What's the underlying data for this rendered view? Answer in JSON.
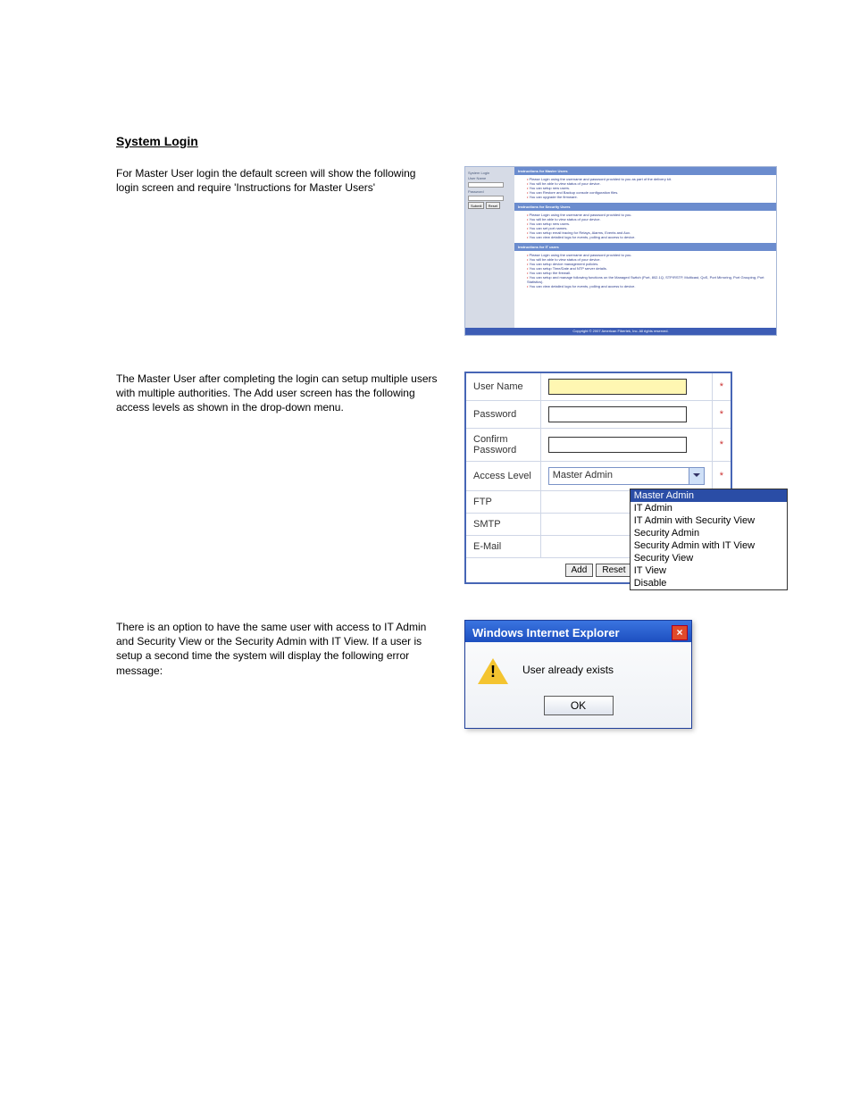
{
  "section_title": "System Login",
  "intro_text": "For Master User login the default screen will show the following login screen and require 'Instructions for Master Users'",
  "login_panel": {
    "title": "System Login",
    "user_label": "User Name",
    "pass_label": "Password",
    "submit": "Submit",
    "reset": "Reset",
    "group1_head": "Instructions for Master Users",
    "group1_items": [
      "Please Login using the username and password provided to you as part of the delivery kit.",
      "You will be able to view status of your device.",
      "You can setup new users.",
      "You can Restore and Backup console configuration files.",
      "You can upgrade the firmware."
    ],
    "group2_head": "Instructions for Security Users",
    "group2_items": [
      "Please Login using the username and password provided to you.",
      "You will be able to view status of your device.",
      "You can setup new users.",
      "You can set port names.",
      "You can setup email tracing for Relays, Alarms, Events and Aux.",
      "You can view detailed logs for events, polling and access to device."
    ],
    "group3_head": "Instructions for IT users",
    "group3_items": [
      "Please Login using the username and password provided to you.",
      "You will be able to view status of your device.",
      "You can setup device management policies.",
      "You can setup Time/Date and NTP server details.",
      "You can setup the firewall.",
      "You can setup and manage following functions on the Managed Switch (Port, 802.1Q, STP/RSTP, Multicast, QoS, Port Mirroring, Port Grouping, Port Statistics).",
      "You can view detailed logs for events, polling and access to device."
    ],
    "footer": "Copyright © 2007 American Fibertek, Inc. All rights reserved."
  },
  "adduser_text": "The Master User after completing the login can setup multiple users with multiple authorities. The Add user screen has the following access levels as shown in the drop-down menu.",
  "form": {
    "username_label": "User Name",
    "password_label": "Password",
    "confirm_label": "Confirm Password",
    "access_label": "Access Level",
    "ftp_label": "FTP",
    "smtp_label": "SMTP",
    "email_label": "E-Mail",
    "selected_level": "Master Admin",
    "options": [
      "Master Admin",
      "IT Admin",
      "IT Admin with Security View",
      "Security Admin",
      "Security Admin with IT View",
      "Security View",
      "IT View",
      "Disable"
    ],
    "add_btn": "Add",
    "reset_btn": "Reset",
    "asterisk": "*"
  },
  "dup_text": "There is an option to have the same user with access to IT Admin and Security View or the Security Admin with IT View. If a user is setup a second time the system will display the following error message:",
  "dialog": {
    "title": "Windows Internet Explorer",
    "message": "User already exists",
    "ok": "OK"
  }
}
